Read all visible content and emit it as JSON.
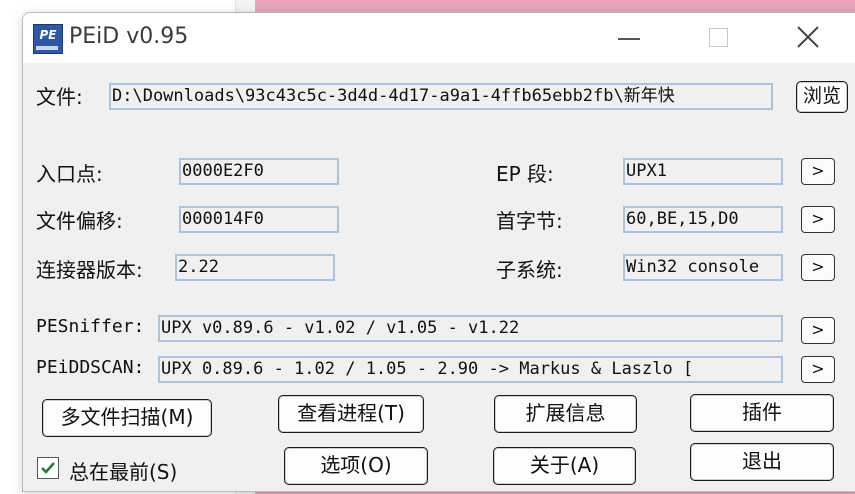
{
  "window": {
    "title": "PEiD v0.95",
    "app_icon_text": "PE"
  },
  "file": {
    "label": "文件:",
    "path": "D:\\Downloads\\93c43c5c-3d4d-4d17-a9a1-4ffb65ebb2fb\\新年快",
    "browse_label": "浏览"
  },
  "info": {
    "entry_point_label": "入口点:",
    "entry_point": "0000E2F0",
    "file_offset_label": "文件偏移:",
    "file_offset": "000014F0",
    "linker_label": "连接器版本:",
    "linker_version": "2.22",
    "ep_section_label": "EP 段:",
    "ep_section": "UPX1",
    "first_bytes_label": "首字节:",
    "first_bytes": "60,BE,15,D0",
    "subsystem_label": "子系统:",
    "subsystem": "Win32 console"
  },
  "scan": {
    "pesniffer_label": "PESniffer:",
    "pesniffer": "UPX v0.89.6 - v1.02 / v1.05 - v1.22",
    "peiddscan_label": "PEiDDSCAN:",
    "peiddscan": "UPX 0.89.6 - 1.02 / 1.05 - 2.90 -> Markus & Laszlo ["
  },
  "arrow_glyph": ">",
  "buttons": {
    "multi_scan": "多文件扫描(M)",
    "view_process": "查看进程(T)",
    "ext_info": "扩展信息",
    "plugins": "插件",
    "options": "选项(O)",
    "about": "关于(A)",
    "exit": "退出"
  },
  "always_on_top": {
    "label": "总在最前(S)",
    "checked": true
  },
  "colors": {
    "pink_bg": "#e9a3bd",
    "check_green": "#1e7f32",
    "field_border": "#a9c4dc"
  }
}
